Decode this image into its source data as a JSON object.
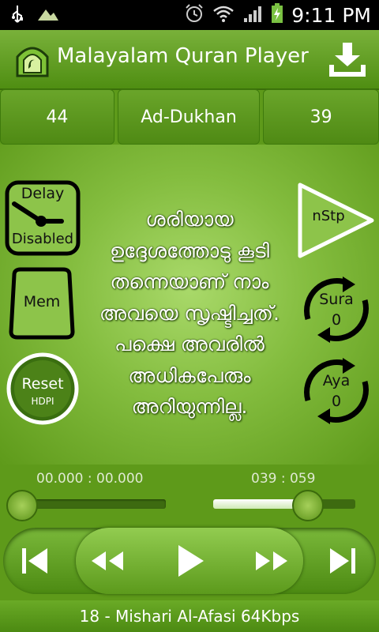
{
  "status_bar": {
    "time": "9:11 PM",
    "icons": [
      "usb-icon",
      "mountain-notification-icon",
      "alarm-icon",
      "wifi-icon",
      "signal-icon",
      "battery-charging-icon"
    ]
  },
  "app": {
    "title": "Malayalam Quran Player",
    "icon": "mosque-app-icon",
    "download_icon": "download-icon"
  },
  "info": {
    "sura_number": "44",
    "sura_name": "Ad-Dukhan",
    "aya_count": "39"
  },
  "controls": {
    "delay_top": "Delay",
    "delay_bottom": "Disabled",
    "mem": "Mem",
    "reset": "Reset",
    "reset_sub": "HDPI",
    "nstp": "nStp",
    "sura_label": "Sura",
    "sura_value": "0",
    "aya_label": "Aya",
    "aya_value": "0"
  },
  "verse_text": "ശരിയായ ഉദ്ദേശത്തോടു കൂടി തന്നെയാണ് നാം അവയെ സൃഷ്ടിച്ചത്. പക്ഷെ അവരില്‍ അധികപേരും അറിയുന്നില്ല.",
  "time_left": "00.000 : 00.000",
  "time_right": "039 : 059",
  "player": {
    "icons": [
      "skip-previous-icon",
      "rewind-icon",
      "play-icon",
      "fast-forward-icon",
      "skip-next-icon"
    ]
  },
  "footer_text": "18 - Mishari Al-Afasi 64Kbps",
  "colors": {
    "background": "#5e9a1a",
    "accent_light": "#a9d96a",
    "text": "#ffffff"
  }
}
